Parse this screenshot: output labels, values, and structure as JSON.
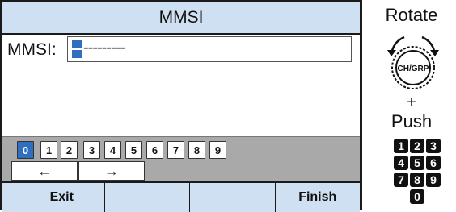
{
  "screen": {
    "title": "MMSI",
    "field_label": "MMSI:",
    "field_value": "---------",
    "keypad_digits": [
      "0",
      "1",
      "2",
      "3",
      "4",
      "5",
      "6",
      "7",
      "8",
      "9"
    ],
    "selected_digit": "0",
    "arrow_left": "←",
    "arrow_right": "→",
    "softkeys": [
      "Exit",
      "",
      "",
      "Finish"
    ]
  },
  "panel": {
    "rotate": "Rotate",
    "knob_label": "CH/GRP",
    "plus": "+",
    "push": "Push",
    "digit_rows": [
      [
        "1",
        "2",
        "3"
      ],
      [
        "4",
        "5",
        "6"
      ],
      [
        "7",
        "8",
        "9"
      ],
      [
        "0"
      ]
    ]
  },
  "colors": {
    "accent": "#2f6fc0",
    "bar": "#cfe0f2",
    "keypad_bg": "#a9a9a9"
  }
}
